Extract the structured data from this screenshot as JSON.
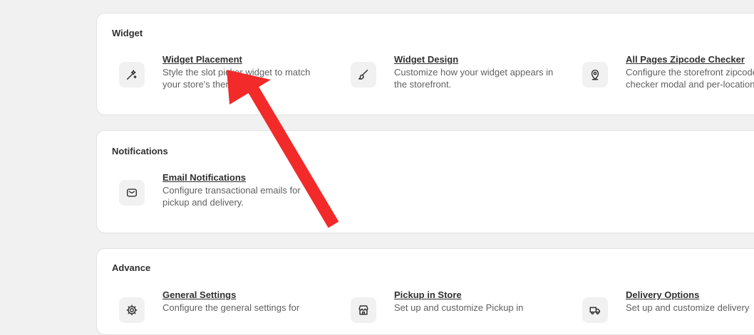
{
  "sections": [
    {
      "title": "Widget",
      "items": [
        {
          "title": "Widget Placement",
          "description": "Style the slot picker widget to match your store's theme.",
          "icon": "magic-wand-icon"
        },
        {
          "title": "Widget Design",
          "description": "Customize how your widget appears in the storefront.",
          "icon": "brush-icon"
        },
        {
          "title": "All Pages Zipcode Checker",
          "description": "Configure the storefront zipcode checker modal and per-location",
          "icon": "location-pin-icon"
        }
      ]
    },
    {
      "title": "Notifications",
      "items": [
        {
          "title": "Email Notifications",
          "description": "Configure transactional emails for pickup and delivery.",
          "icon": "envelope-icon"
        }
      ]
    },
    {
      "title": "Advance",
      "items": [
        {
          "title": "General Settings",
          "description": "Configure the general settings for",
          "icon": "gear-icon"
        },
        {
          "title": "Pickup in Store",
          "description": "Set up and customize Pickup in",
          "icon": "store-icon"
        },
        {
          "title": "Delivery Options",
          "description": "Set up and customize delivery",
          "icon": "truck-icon"
        }
      ]
    }
  ],
  "annotation": {
    "color": "#f22a2a"
  }
}
